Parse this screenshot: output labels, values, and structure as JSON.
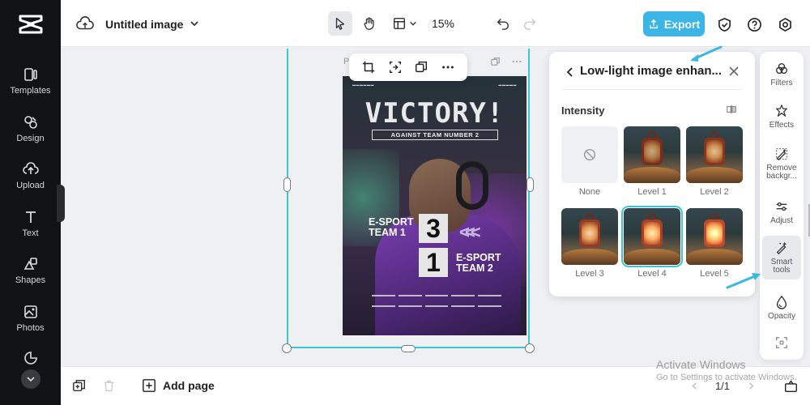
{
  "app": {
    "document_title": "Untitled image",
    "zoom": "15%",
    "export_label": "Export"
  },
  "sidebar": {
    "items": [
      {
        "label": "Templates",
        "icon": "templates-icon"
      },
      {
        "label": "Design",
        "icon": "design-icon"
      },
      {
        "label": "Upload",
        "icon": "upload-icon"
      },
      {
        "label": "Text",
        "icon": "text-icon"
      },
      {
        "label": "Shapes",
        "icon": "shapes-icon"
      },
      {
        "label": "Photos",
        "icon": "photos-icon"
      }
    ]
  },
  "canvas": {
    "page_label": "P",
    "poster": {
      "headline": "VICTORY!",
      "subheadline": "AGAINST TEAM NUMBER 2",
      "team1": [
        "E-SPORT",
        "TEAM 1"
      ],
      "team2": [
        "E-SPORT",
        "TEAM 2"
      ],
      "score1": "3",
      "score2": "1",
      "chevrons": "<<<"
    }
  },
  "panel": {
    "title": "Low-light image enhan...",
    "intensity_label": "Intensity",
    "options": [
      {
        "label": "None",
        "selected": false
      },
      {
        "label": "Level 1",
        "selected": false
      },
      {
        "label": "Level 2",
        "selected": false
      },
      {
        "label": "Level 3",
        "selected": false
      },
      {
        "label": "Level 4",
        "selected": true
      },
      {
        "label": "Level 5",
        "selected": false
      }
    ]
  },
  "rail": {
    "items": [
      {
        "label": "Filters",
        "icon": "filters-icon"
      },
      {
        "label": "Effects",
        "icon": "effects-icon"
      },
      {
        "label": "Remove backgr...",
        "icon": "remove-background-icon"
      },
      {
        "label": "Adjust",
        "icon": "adjust-icon"
      },
      {
        "label": "Smart tools",
        "icon": "smart-tools-icon",
        "active": true
      },
      {
        "label": "Opacity",
        "icon": "opacity-icon"
      }
    ]
  },
  "bottombar": {
    "add_page_label": "Add page",
    "page_count": "1/1"
  },
  "overlay": {
    "activate_title": "Activate Windows",
    "activate_sub": "Go to Settings to activate Windows."
  },
  "colors": {
    "accent": "#3bb5e6",
    "selection": "#3cc6d6",
    "sidebar_bg": "#111214"
  }
}
